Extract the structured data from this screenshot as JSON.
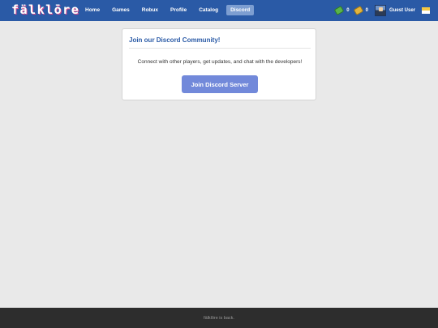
{
  "header": {
    "logo": "fälklōre",
    "nav": [
      {
        "label": "Home"
      },
      {
        "label": "Games"
      },
      {
        "label": "Robux"
      },
      {
        "label": "Profile"
      },
      {
        "label": "Catalog"
      },
      {
        "label": "Discord",
        "active": true
      }
    ],
    "robux_count": "0",
    "tix_count": "0",
    "username": "Guest User",
    "robux_icon": "robux-currency-icon",
    "tix_icon": "tix-currency-icon",
    "mail_icon": "mail-icon"
  },
  "main": {
    "card_title": "Join our Discord Community!",
    "card_body": "Connect with other players, get updates, and chat with the developers!",
    "button_label": "Join Discord Server"
  },
  "footer": {
    "text": "fälklōre is back."
  },
  "colors": {
    "nav_bg": "#2a5aa6",
    "accent": "#7289da",
    "page_bg": "#e9e9e9",
    "footer_bg": "#2d2d2d"
  }
}
